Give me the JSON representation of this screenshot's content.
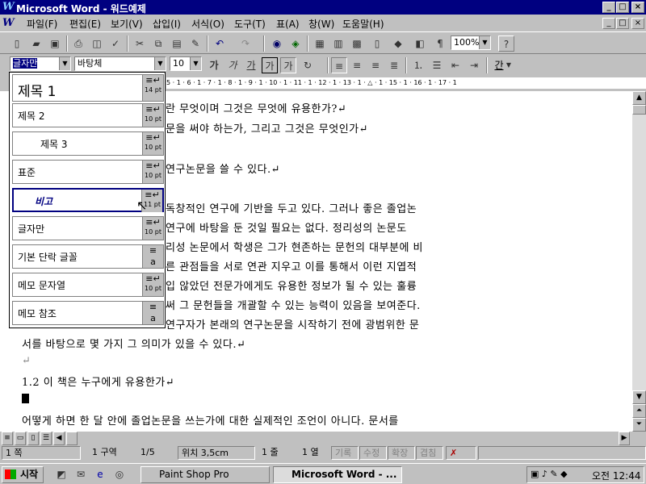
{
  "window": {
    "title": "Microsoft Word - 워드예제",
    "min": "_",
    "max": "□",
    "close": "×"
  },
  "menu": [
    "파일(F)",
    "편집(E)",
    "보기(V)",
    "삽입(I)",
    "서식(O)",
    "도구(T)",
    "표(A)",
    "창(W)",
    "도움말(H)"
  ],
  "toolbar": {
    "zoom": "100%"
  },
  "format": {
    "style": "글자만",
    "font": "바탕체",
    "size": "10",
    "bold": "가",
    "italic": "가",
    "underline": "가",
    "outline": "가",
    "shadow": "가",
    "char": "간"
  },
  "ruler": "5 · 1 · 6 · 1 · 7 · 1 · 8 · 1 · 9 · 1 · 10 · 1 · 11 · 1 · 12 · 1 · 13 · 1 · △ · 1 · 15 · 1 · 16 · 1 · 17 · 1",
  "styles": [
    {
      "name": "제목 1",
      "size": "14 pt"
    },
    {
      "name": "제목 2",
      "size": "10 pt"
    },
    {
      "name": "제목 3",
      "size": "10 pt"
    },
    {
      "name": "표준",
      "size": "10 pt"
    },
    {
      "name": "비고",
      "size": "11 pt"
    },
    {
      "name": "글자만",
      "size": "10 pt"
    },
    {
      "name": "기본 단락 글꼴",
      "size": ""
    },
    {
      "name": "메모 문자열",
      "size": "10 pt"
    },
    {
      "name": "메모 참조",
      "size": ""
    }
  ],
  "document": {
    "lines": [
      "란 무엇이며 그것은 무엇에 유용한가?↵",
      "문을 써야 하는가, 그리고 그것은 무엇인가↵",
      "",
      "연구논문을 쓸 수 있다.↵",
      "",
      "독창적인 연구에 기반을 두고 있다. 그러나 좋은 졸업논",
      "연구에 바탕을 둔 것일 필요는 없다. 정리성의 논문도",
      "리성 논문에서 학생은 그가 현존하는 문헌의 대부분에 비",
      "른 관점들을 서로 연관 지우고 이를 통해서 이런 지엽적",
      "입 않았던 전문가에게도 유용한 정보가 될 수 있는 훌륭",
      "써 그 문헌들을 개괄할 수 있는 능력이 있음을 보여준다.",
      "연구자가 본래의 연구논문을 시작하기 전에 광범위한 문"
    ],
    "full_lines": [
      "서를 바탕으로 몇 가지 그 의미가 있을 수 있다.↵",
      "↵",
      "1.2 이 책은 누구에게 유용한가↵",
      "어떻게 하면 한 달 안에 졸업논문을 쓰는가에 대한 실제적인 조언이 아니다. 문서를"
    ]
  },
  "status": {
    "page": "1 쪽",
    "section": "1 구역",
    "pages": "1/5",
    "pos": "위치 3,5cm",
    "line": "1 줄",
    "col": "1 열",
    "rec": "기록",
    "trk": "수정",
    "ext": "확장",
    "ovr": "겹침"
  },
  "taskbar": {
    "start": "시작",
    "task1": "Paint Shop Pro",
    "task2": "Microsoft Word - ...",
    "clock": "오전 12:44"
  }
}
